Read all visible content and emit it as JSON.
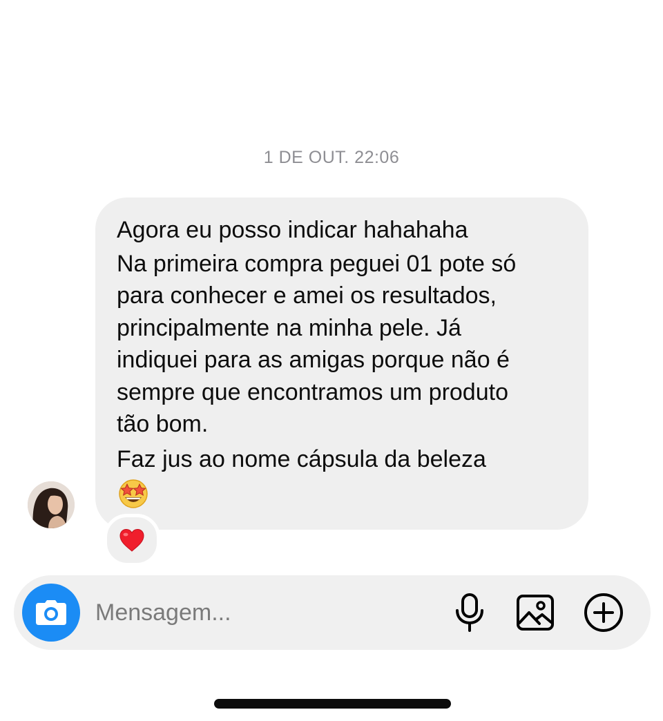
{
  "conversation": {
    "timestamp": "1 DE OUT. 22:06",
    "message": {
      "lines": [
        "Agora eu posso indicar hahahaha",
        "Na primeira compra peguei 01 pote só",
        "para conhecer  e amei os resultados,",
        "principalmente na minha pele. Já",
        "indiquei para as amigas porque não é",
        "sempre que encontramos um produto",
        "tão bom.",
        "Faz jus ao nome cápsula da beleza"
      ],
      "emoji_icon": "star-struck-emoji",
      "reaction_icon": "red-heart-icon",
      "bubble_color": "#efefef"
    },
    "sender_avatar": "avatar-photo"
  },
  "composer": {
    "placeholder": "Mensagem...",
    "camera_icon": "camera-icon",
    "camera_color": "#1b8cf5",
    "mic_icon": "microphone-icon",
    "gallery_icon": "image-icon",
    "add_icon": "plus-circle-icon"
  }
}
